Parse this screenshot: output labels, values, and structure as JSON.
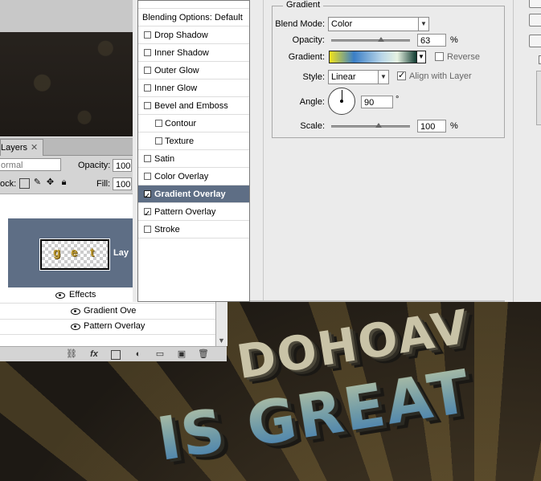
{
  "layers_panel": {
    "tab_label": "Layers",
    "blend_mode_partial": "ormal",
    "opacity_label": "Opacity:",
    "opacity_value": "100",
    "lock_label": "ock:",
    "fill_label": "Fill:",
    "fill_value": "100",
    "layer_name_partial": "Lay",
    "effects_label": "Effects",
    "effect_1": "Gradient Ove",
    "effect_2": "Pattern Overlay"
  },
  "styles_list": {
    "header": "Blending Options: Default",
    "items": [
      {
        "label": "Drop Shadow",
        "checked": false
      },
      {
        "label": "Inner Shadow",
        "checked": false
      },
      {
        "label": "Outer Glow",
        "checked": false
      },
      {
        "label": "Inner Glow",
        "checked": false
      },
      {
        "label": "Bevel and Emboss",
        "checked": false
      },
      {
        "label": "Contour",
        "checked": false
      },
      {
        "label": "Texture",
        "checked": false
      },
      {
        "label": "Satin",
        "checked": false
      },
      {
        "label": "Color Overlay",
        "checked": false
      },
      {
        "label": "Gradient Overlay",
        "checked": true
      },
      {
        "label": "Pattern Overlay",
        "checked": true
      },
      {
        "label": "Stroke",
        "checked": false
      }
    ]
  },
  "gradient_panel": {
    "group_title": "Gradient",
    "blend_mode_label": "Blend Mode:",
    "blend_mode_value": "Color",
    "opacity_label": "Opacity:",
    "opacity_value": "63",
    "opacity_fraction": 0.63,
    "percent": "%",
    "gradient_label": "Gradient:",
    "gradient_colors": [
      "#f2e31a",
      "#3a7ec6",
      "#b9d6e8",
      "#e6f2e2",
      "#0f3a30"
    ],
    "reverse_label": "Reverse",
    "reverse_checked": false,
    "style_label": "Style:",
    "style_value": "Linear",
    "align_label": "Align with Layer",
    "align_checked": true,
    "angle_label": "Angle:",
    "angle_value": "90",
    "degree": "°",
    "scale_label": "Scale:",
    "scale_value": "100",
    "scale_fraction": 0.6
  },
  "artwork": {
    "line1": "DOHOAV",
    "line2": "IS GREAT"
  },
  "colors": {
    "selection": "#5e6e85",
    "dialog_bg": "#ebebeb"
  }
}
